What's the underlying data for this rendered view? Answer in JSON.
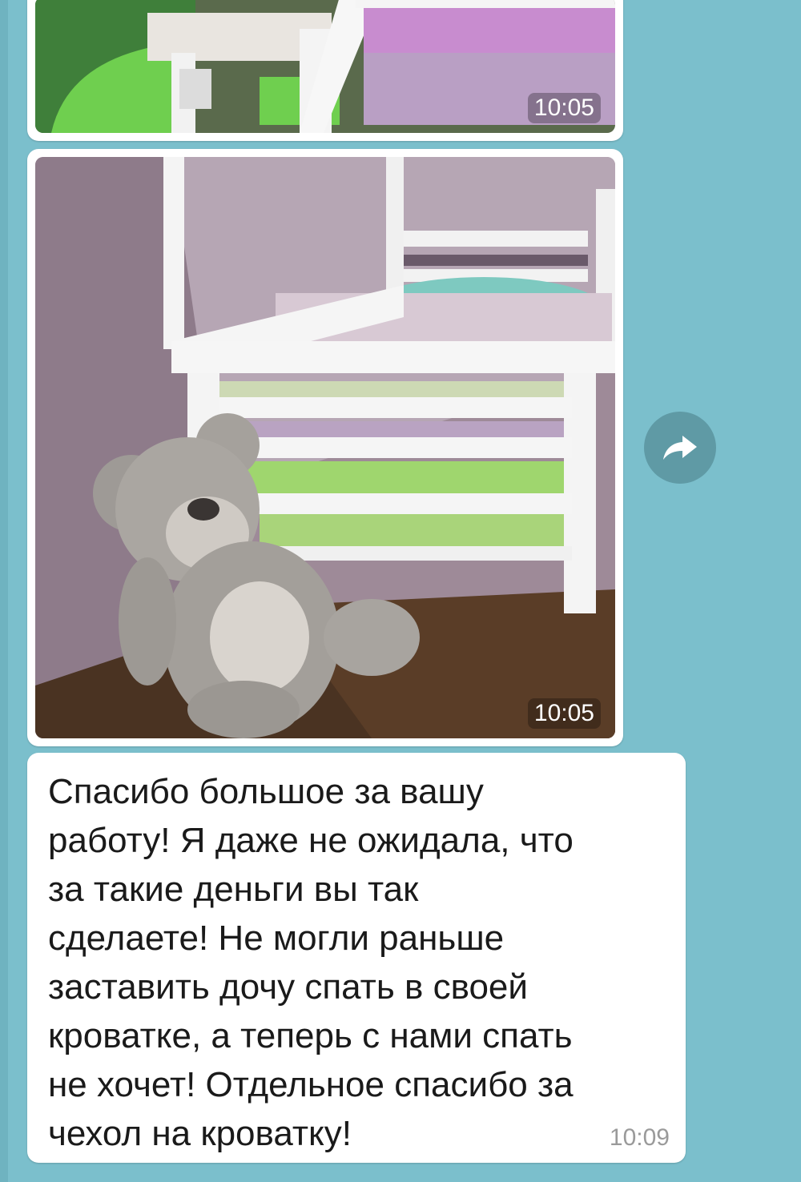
{
  "chat": {
    "messages": [
      {
        "type": "photo",
        "time": "10:05",
        "alt": ""
      },
      {
        "type": "photo",
        "time": "10:05",
        "alt": ""
      },
      {
        "type": "text",
        "text": "Спасибо большое за вашу\nработу! Я даже не ожидала, что\nза такие деньги вы так\nсделаете! Не могли раньше\nзаставить дочу спать в своей\nкроватке, а теперь с нами спать\nне хочет! Отдельное спасибо за\nчехол на кроватку!",
        "time": "10:09"
      }
    ],
    "share_icon": "share-arrow-icon"
  },
  "colors": {
    "background": "#7bbfcc",
    "bubble": "#ffffff",
    "share_button": "#5f9aa5"
  }
}
